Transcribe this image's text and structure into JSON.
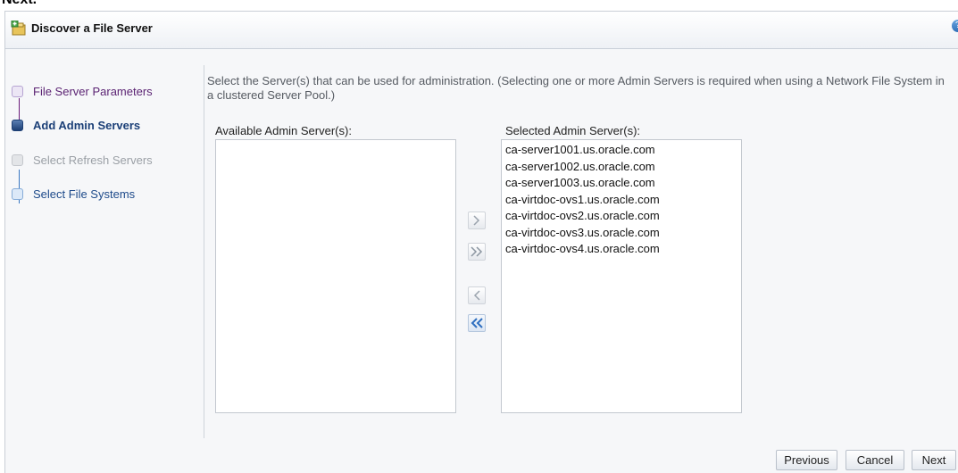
{
  "top_fragment": "Next.",
  "dialog": {
    "title": "Discover a File Server",
    "help_icon": "help-icon"
  },
  "train": {
    "steps": [
      {
        "label": "File Server Parameters",
        "state": "visited"
      },
      {
        "label": "Add Admin Servers",
        "state": "current"
      },
      {
        "label": "Select Refresh Servers",
        "state": "disabled"
      },
      {
        "label": "Select File Systems",
        "state": "unvisited"
      }
    ]
  },
  "instructions": "Select the Server(s) that can be used for administration. (Selecting one or more Admin Servers is required when using a Network File System in a clustered Server Pool.)",
  "shuttle": {
    "available_label": "Available Admin Server(s):",
    "selected_label": "Selected Admin Server(s):",
    "available_items": [],
    "selected_items": [
      "ca-server1001.us.oracle.com",
      "ca-server1002.us.oracle.com",
      "ca-server1003.us.oracle.com",
      "ca-virtdoc-ovs1.us.oracle.com",
      "ca-virtdoc-ovs2.us.oracle.com",
      "ca-virtdoc-ovs3.us.oracle.com",
      "ca-virtdoc-ovs4.us.oracle.com"
    ],
    "buttons": {
      "move": "chevron-right-icon",
      "move_all": "double-chevron-right-icon",
      "remove": "chevron-left-icon",
      "remove_all": "double-chevron-left-icon"
    }
  },
  "footer": {
    "previous_label": "Previous",
    "cancel_label": "Cancel",
    "next_label": "Next"
  },
  "colors": {
    "accent": "#1b3f77",
    "visited": "#5b2373",
    "disabled": "#9ba0a6",
    "remove_all_icon": "#2f6fc0"
  }
}
